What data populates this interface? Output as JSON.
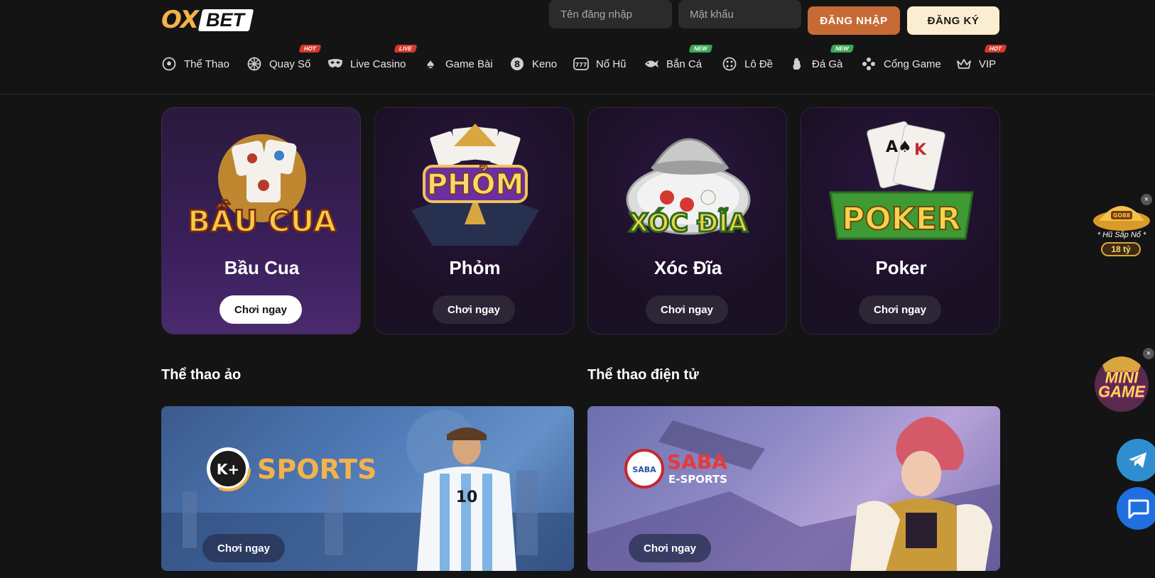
{
  "header": {
    "logo_ox": "OX",
    "logo_bet": "BET",
    "username_placeholder": "Tên đăng nhập",
    "password_placeholder": "Mật khẩu",
    "login_label": "ĐĂNG NHẬP",
    "register_label": "ĐĂNG KÝ"
  },
  "nav": [
    {
      "label": "Thể Thao",
      "icon": "soccer-ball-icon",
      "badge": ""
    },
    {
      "label": "Quay Số",
      "icon": "lottery-wheel-icon",
      "badge": "HOT"
    },
    {
      "label": "Live Casino",
      "icon": "mask-icon",
      "badge": "LIVE"
    },
    {
      "label": "Game Bài",
      "icon": "spade-icon",
      "badge": ""
    },
    {
      "label": "Keno",
      "icon": "keno-ball-icon",
      "badge": ""
    },
    {
      "label": "Nổ Hũ",
      "icon": "slot-777-icon",
      "badge": ""
    },
    {
      "label": "Bắn Cá",
      "icon": "fish-icon",
      "badge": "NEW"
    },
    {
      "label": "Lô Đề",
      "icon": "lottery-ticket-icon",
      "badge": ""
    },
    {
      "label": "Đá Gà",
      "icon": "rooster-icon",
      "badge": "NEW"
    },
    {
      "label": "Cổng Game",
      "icon": "gamepad-icon",
      "badge": ""
    },
    {
      "label": "VIP",
      "icon": "crown-icon",
      "badge": "HOT"
    }
  ],
  "games": [
    {
      "title": "Bầu Cua",
      "art": "BẦU CUA",
      "button": "Chơi ngay"
    },
    {
      "title": "Phỏm",
      "art": "PHỎM",
      "button": "Chơi ngay"
    },
    {
      "title": "Xóc Đĩa",
      "art": "XÓC ĐĨA",
      "button": "Chơi ngay"
    },
    {
      "title": "Poker",
      "art": "POKER",
      "button": "Chơi ngay"
    }
  ],
  "sections": {
    "virtual_sports": "Thể thao ảo",
    "esports": "Thể thao điện tử"
  },
  "banners": {
    "sports_logo": "SPORTS",
    "sports_badge": "K+",
    "sports_button": "Chơi ngay",
    "esports_logo_top": "SABA",
    "esports_logo_bottom": "E-SPORTS",
    "esports_button": "Chơi ngay"
  },
  "floating": {
    "jackpot_label": "* Hũ Sắp Nổ *",
    "jackpot_value": "18 tỷ",
    "mini_game_line1": "MINI",
    "mini_game_line2": "GAME"
  },
  "colors": {
    "background": "#141414",
    "login_button": "#c86a35",
    "register_button": "#fbedcf",
    "logo_accent": "#f3b24a",
    "badge_hot": "#d6382f",
    "badge_new": "#3aa856"
  }
}
